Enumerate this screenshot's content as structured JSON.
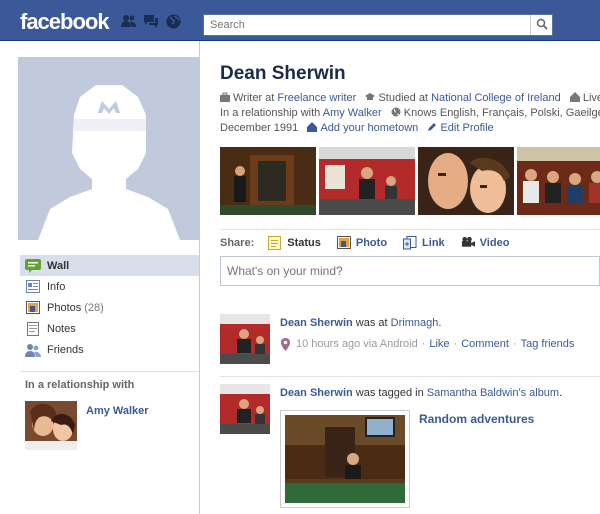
{
  "header": {
    "logo": "facebook",
    "search_placeholder": "Search"
  },
  "sidebar": {
    "nav": [
      {
        "label": "Wall",
        "icon": "wall-icon",
        "active": true
      },
      {
        "label": "Info",
        "icon": "info-icon"
      },
      {
        "label": "Photos",
        "count": "(28)",
        "icon": "photos-icon"
      },
      {
        "label": "Notes",
        "icon": "notes-icon"
      },
      {
        "label": "Friends",
        "icon": "friends-icon"
      }
    ],
    "relationship_heading": "In a relationship with",
    "relationship_name": "Amy Walker"
  },
  "profile": {
    "name": "Dean Sherwin",
    "work_prefix": "Writer at",
    "work_link": "Freelance writer",
    "study_prefix": "Studied at",
    "study_link": "National College of Ireland",
    "lives_prefix": "Live",
    "relationship_prefix": "In a relationship with",
    "relationship_link": "Amy Walker",
    "languages": "Knows English, Français, Polski, Gaeilge",
    "birthday": "December 1991",
    "add_hometown": "Add your hometown",
    "edit_profile": "Edit Profile"
  },
  "share": {
    "label": "Share:",
    "items": [
      "Status",
      "Photo",
      "Link",
      "Video"
    ],
    "composer_placeholder": "What's on your mind?"
  },
  "stories": [
    {
      "actor": "Dean Sherwin",
      "text": " was at ",
      "place": "Drimnagh",
      "suffix": ".",
      "time": "10 hours ago via Android",
      "actions": [
        "Like",
        "Comment",
        "Tag friends"
      ]
    },
    {
      "actor": "Dean Sherwin",
      "text": " was tagged in ",
      "owner": "Samantha Baldwin's album",
      "suffix": ".",
      "album_title": "Random adventures"
    }
  ],
  "colors": {
    "brand_blue": "#3b5998",
    "link_blue": "#3b5998",
    "nav_active_bg": "#d8dfea"
  }
}
